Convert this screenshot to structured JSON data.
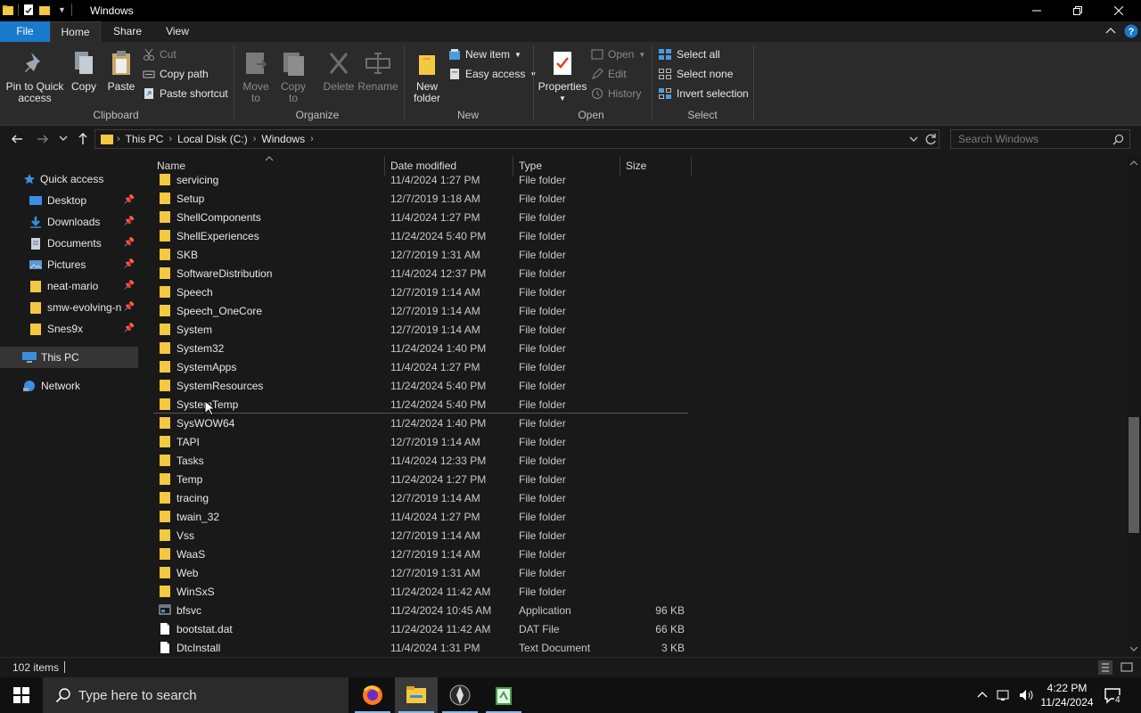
{
  "window": {
    "title": "Windows"
  },
  "tabs": {
    "file": "File",
    "home": "Home",
    "share": "Share",
    "view": "View"
  },
  "ribbon": {
    "clipboard": {
      "label": "Clipboard",
      "pin_line1": "Pin to Quick",
      "pin_line2": "access",
      "copy": "Copy",
      "paste": "Paste",
      "cut": "Cut",
      "copy_path": "Copy path",
      "paste_shortcut": "Paste shortcut"
    },
    "organize": {
      "label": "Organize",
      "move_line1": "Move",
      "move_line2": "to",
      "copy_line1": "Copy",
      "copy_line2": "to",
      "delete": "Delete",
      "rename": "Rename"
    },
    "new": {
      "label": "New",
      "new_folder_line1": "New",
      "new_folder_line2": "folder",
      "new_item": "New item",
      "easy_access": "Easy access"
    },
    "open": {
      "label": "Open",
      "properties": "Properties",
      "open": "Open",
      "edit": "Edit",
      "history": "History"
    },
    "select": {
      "label": "Select",
      "select_all": "Select all",
      "select_none": "Select none",
      "invert": "Invert selection"
    }
  },
  "address": {
    "crumbs": [
      "This PC",
      "Local Disk (C:)",
      "Windows"
    ]
  },
  "search": {
    "placeholder": "Search Windows"
  },
  "navpane": {
    "quick_access": "Quick access",
    "items": [
      "Desktop",
      "Downloads",
      "Documents",
      "Pictures",
      "neat-mario",
      "smw-evolving-n",
      "Snes9x"
    ],
    "this_pc": "This PC",
    "network": "Network"
  },
  "columns": {
    "name": "Name",
    "date": "Date modified",
    "type": "Type",
    "size": "Size"
  },
  "files": [
    {
      "name": "servicing",
      "date": "11/4/2024 1:27 PM",
      "type": "File folder",
      "size": "",
      "kind": "folder"
    },
    {
      "name": "Setup",
      "date": "12/7/2019 1:18 AM",
      "type": "File folder",
      "size": "",
      "kind": "folder"
    },
    {
      "name": "ShellComponents",
      "date": "11/4/2024 1:27 PM",
      "type": "File folder",
      "size": "",
      "kind": "folder"
    },
    {
      "name": "ShellExperiences",
      "date": "11/24/2024 5:40 PM",
      "type": "File folder",
      "size": "",
      "kind": "folder"
    },
    {
      "name": "SKB",
      "date": "12/7/2019 1:31 AM",
      "type": "File folder",
      "size": "",
      "kind": "folder"
    },
    {
      "name": "SoftwareDistribution",
      "date": "11/4/2024 12:37 PM",
      "type": "File folder",
      "size": "",
      "kind": "folder"
    },
    {
      "name": "Speech",
      "date": "12/7/2019 1:14 AM",
      "type": "File folder",
      "size": "",
      "kind": "folder"
    },
    {
      "name": "Speech_OneCore",
      "date": "12/7/2019 1:14 AM",
      "type": "File folder",
      "size": "",
      "kind": "folder"
    },
    {
      "name": "System",
      "date": "12/7/2019 1:14 AM",
      "type": "File folder",
      "size": "",
      "kind": "folder"
    },
    {
      "name": "System32",
      "date": "11/24/2024 1:40 PM",
      "type": "File folder",
      "size": "",
      "kind": "folder"
    },
    {
      "name": "SystemApps",
      "date": "11/4/2024 1:27 PM",
      "type": "File folder",
      "size": "",
      "kind": "folder"
    },
    {
      "name": "SystemResources",
      "date": "11/24/2024 5:40 PM",
      "type": "File folder",
      "size": "",
      "kind": "folder"
    },
    {
      "name": "SystemTemp",
      "date": "11/24/2024 5:40 PM",
      "type": "File folder",
      "size": "",
      "kind": "folder"
    },
    {
      "name": "SysWOW64",
      "date": "11/24/2024 1:40 PM",
      "type": "File folder",
      "size": "",
      "kind": "folder"
    },
    {
      "name": "TAPI",
      "date": "12/7/2019 1:14 AM",
      "type": "File folder",
      "size": "",
      "kind": "folder"
    },
    {
      "name": "Tasks",
      "date": "11/4/2024 12:33 PM",
      "type": "File folder",
      "size": "",
      "kind": "folder"
    },
    {
      "name": "Temp",
      "date": "11/24/2024 1:27 PM",
      "type": "File folder",
      "size": "",
      "kind": "folder"
    },
    {
      "name": "tracing",
      "date": "12/7/2019 1:14 AM",
      "type": "File folder",
      "size": "",
      "kind": "folder"
    },
    {
      "name": "twain_32",
      "date": "11/4/2024 1:27 PM",
      "type": "File folder",
      "size": "",
      "kind": "folder"
    },
    {
      "name": "Vss",
      "date": "12/7/2019 1:14 AM",
      "type": "File folder",
      "size": "",
      "kind": "folder"
    },
    {
      "name": "WaaS",
      "date": "12/7/2019 1:14 AM",
      "type": "File folder",
      "size": "",
      "kind": "folder"
    },
    {
      "name": "Web",
      "date": "12/7/2019 1:31 AM",
      "type": "File folder",
      "size": "",
      "kind": "folder"
    },
    {
      "name": "WinSxS",
      "date": "11/24/2024 11:42 AM",
      "type": "File folder",
      "size": "",
      "kind": "folder"
    },
    {
      "name": "bfsvc",
      "date": "11/24/2024 10:45 AM",
      "type": "Application",
      "size": "96 KB",
      "kind": "app"
    },
    {
      "name": "bootstat.dat",
      "date": "11/24/2024 11:42 AM",
      "type": "DAT File",
      "size": "66 KB",
      "kind": "file"
    },
    {
      "name": "DtcInstall",
      "date": "11/4/2024 1:31 PM",
      "type": "Text Document",
      "size": "3 KB",
      "kind": "file"
    }
  ],
  "status": {
    "count": "102 items"
  },
  "taskbar": {
    "search_placeholder": "Type here to search",
    "time": "4:22 PM",
    "date": "11/24/2024",
    "notifications": "4"
  },
  "colors": {
    "accent": "#1979ca",
    "folder": "#f5c842",
    "background": "#191919"
  }
}
